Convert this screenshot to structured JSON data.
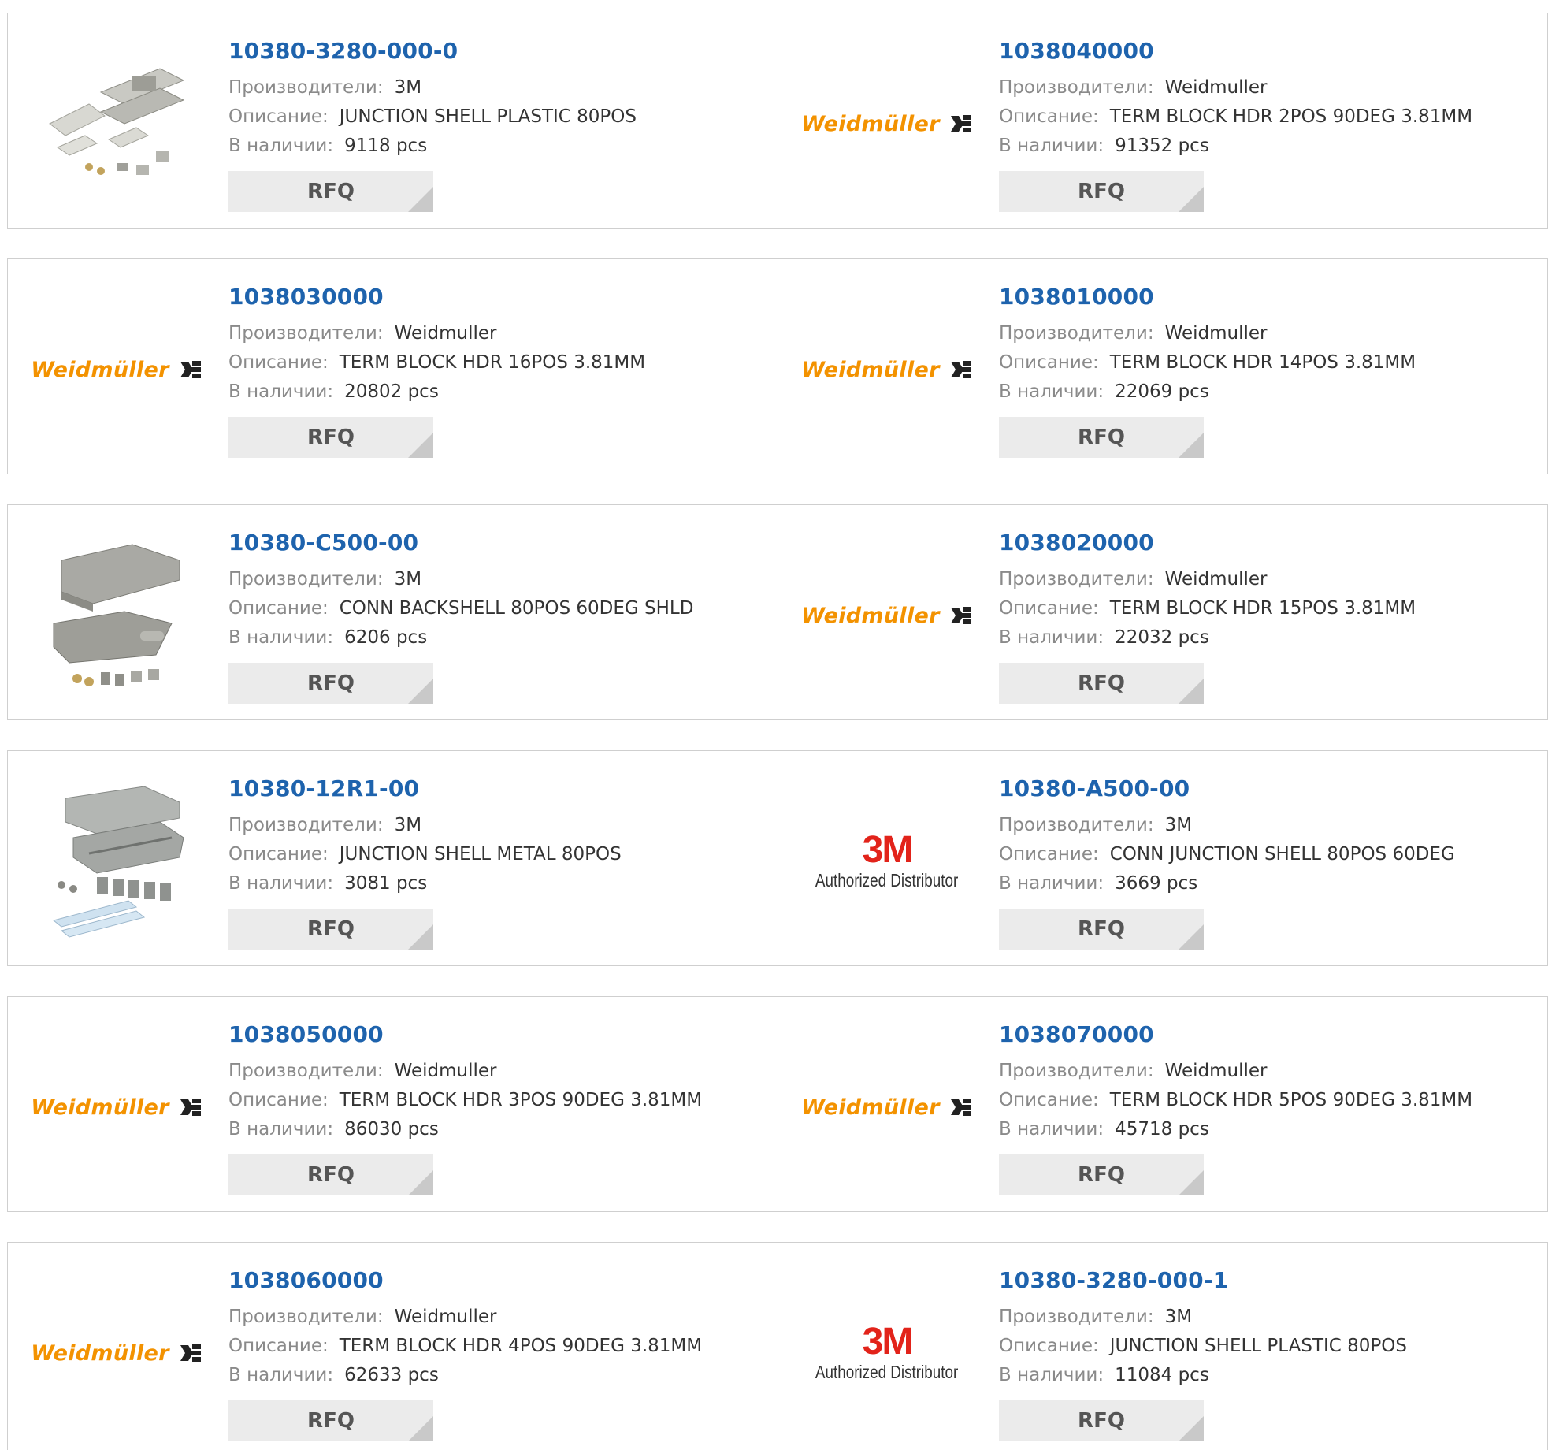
{
  "labels": {
    "manufacturer": "Производители:",
    "description": "Описание:",
    "stock": "В наличии:",
    "rfq": "RFQ"
  },
  "logos": {
    "weidmuller": "Weidmüller",
    "m3": "3M",
    "m3_sub": "Authorized Distributor"
  },
  "colors": {
    "part_link": "#1e63ad",
    "weidmuller_orange": "#f39200",
    "m3_red": "#e2231a",
    "rfq_bg": "#ebebeb"
  },
  "products": [
    {
      "part": "10380-3280-000-0",
      "manufacturer": "3M",
      "description": "JUNCTION SHELL PLASTIC 80POS",
      "stock": "9118 pcs",
      "image": "junction-shell-photo"
    },
    {
      "part": "1038040000",
      "manufacturer": "Weidmuller",
      "description": "TERM BLOCK HDR 2POS 90DEG 3.81MM",
      "stock": "91352 pcs",
      "image": "weidmuller-logo"
    },
    {
      "part": "1038030000",
      "manufacturer": "Weidmuller",
      "description": "TERM BLOCK HDR 16POS 3.81MM",
      "stock": "20802 pcs",
      "image": "weidmuller-logo"
    },
    {
      "part": "1038010000",
      "manufacturer": "Weidmuller",
      "description": "TERM BLOCK HDR 14POS 3.81MM",
      "stock": "22069 pcs",
      "image": "weidmuller-logo"
    },
    {
      "part": "10380-C500-00",
      "manufacturer": "3M",
      "description": "CONN BACKSHELL 80POS 60DEG SHLD",
      "stock": "6206 pcs",
      "image": "backshell-photo"
    },
    {
      "part": "1038020000",
      "manufacturer": "Weidmuller",
      "description": "TERM BLOCK HDR 15POS 3.81MM",
      "stock": "22032 pcs",
      "image": "weidmuller-logo"
    },
    {
      "part": "10380-12R1-00",
      "manufacturer": "3M",
      "description": "JUNCTION SHELL METAL 80POS",
      "stock": "3081 pcs",
      "image": "metal-shell-photo"
    },
    {
      "part": "10380-A500-00",
      "manufacturer": "3M",
      "description": "CONN JUNCTION SHELL 80POS 60DEG",
      "stock": "3669 pcs",
      "image": "3m-logo"
    },
    {
      "part": "1038050000",
      "manufacturer": "Weidmuller",
      "description": "TERM BLOCK HDR 3POS 90DEG 3.81MM",
      "stock": "86030 pcs",
      "image": "weidmuller-logo"
    },
    {
      "part": "1038070000",
      "manufacturer": "Weidmuller",
      "description": "TERM BLOCK HDR 5POS 90DEG 3.81MM",
      "stock": "45718 pcs",
      "image": "weidmuller-logo"
    },
    {
      "part": "1038060000",
      "manufacturer": "Weidmuller",
      "description": "TERM BLOCK HDR 4POS 90DEG 3.81MM",
      "stock": "62633 pcs",
      "image": "weidmuller-logo"
    },
    {
      "part": "10380-3280-000-1",
      "manufacturer": "3M",
      "description": "JUNCTION SHELL PLASTIC 80POS",
      "stock": "11084 pcs",
      "image": "3m-logo"
    }
  ]
}
